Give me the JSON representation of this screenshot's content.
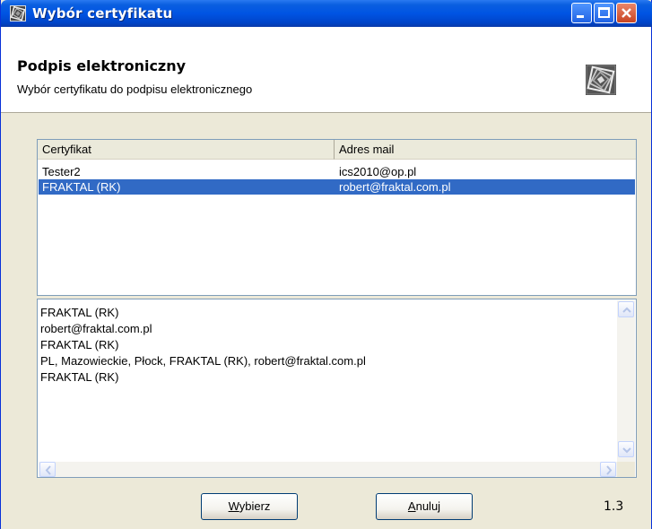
{
  "window": {
    "title": "Wybór certyfikatu",
    "icon": "app-icon",
    "controls": [
      "minimize-icon",
      "maximize-icon",
      "close-icon"
    ]
  },
  "header": {
    "title": "Podpis elektroniczny",
    "subtitle": "Wybór certyfikatu do podpisu elektronicznego",
    "logo": "fractal-logo"
  },
  "list": {
    "columns": [
      "Certyfikat",
      "Adres mail"
    ],
    "rows": [
      {
        "cert": "Tester2",
        "email": "ics2010@op.pl",
        "selected": false
      },
      {
        "cert": "FRAKTAL (RK)",
        "email": "robert@fraktal.com.pl",
        "selected": true
      }
    ]
  },
  "details": {
    "lines": [
      "FRAKTAL (RK)",
      "robert@fraktal.com.pl",
      "FRAKTAL (RK)",
      "PL, Mazowieckie, Płock, FRAKTAL (RK), robert@fraktal.com.pl",
      "FRAKTAL (RK)"
    ]
  },
  "buttons": {
    "select_mnemonic": "W",
    "select_rest": "ybierz",
    "cancel_mnemonic": "A",
    "cancel_rest": "nuluj"
  },
  "version": "1.3",
  "colors": {
    "titlebar": "#0054e3",
    "selection": "#316ac5",
    "dialog_bg": "#ece9d8"
  }
}
